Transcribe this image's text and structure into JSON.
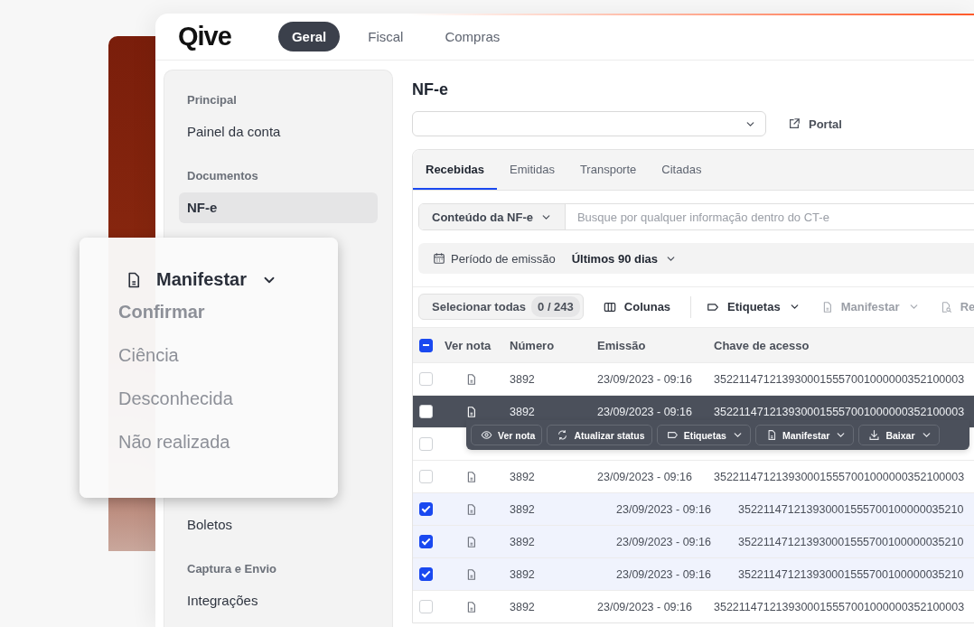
{
  "logo": "Qive",
  "nav_tabs": [
    {
      "label": "Geral",
      "selected": true
    },
    {
      "label": "Fiscal",
      "selected": false
    },
    {
      "label": "Compras",
      "selected": false
    }
  ],
  "sidebar": {
    "sections": [
      {
        "title": "Principal",
        "items": [
          {
            "label": "Painel da conta",
            "selected": false
          }
        ]
      },
      {
        "title": "Documentos",
        "items": [
          {
            "label": "NF-e",
            "selected": true
          }
        ]
      },
      {
        "items": [
          {
            "label": "Boletos",
            "selected": false
          }
        ]
      },
      {
        "title": "Captura e Envio",
        "items": [
          {
            "label": "Integrações",
            "selected": false
          }
        ]
      }
    ]
  },
  "page_title": "NF-e",
  "portal_link": "Portal",
  "doc_tabs": [
    {
      "label": "Recebidas",
      "selected": true
    },
    {
      "label": "Emitidas",
      "selected": false
    },
    {
      "label": "Transporte",
      "selected": false
    },
    {
      "label": "Citadas",
      "selected": false
    }
  ],
  "search": {
    "scope": "Conteúdo da NF-e",
    "placeholder": "Busque por qualquer informação dentro do CT-e"
  },
  "period_filter": {
    "label": "Período de emissão",
    "value": "Últimos 90 dias"
  },
  "toolbar": {
    "select_all": {
      "label": "Selecionar todas",
      "count": "0 / 243"
    },
    "actions": [
      {
        "kind": "columns",
        "label": "Colunas",
        "dropdown": false,
        "disabled": false
      },
      {
        "kind": "tag",
        "label": "Etiquetas",
        "dropdown": true,
        "disabled": false
      },
      {
        "kind": "doc",
        "label": "Manifestar",
        "dropdown": true,
        "disabled": true
      },
      {
        "kind": "search",
        "label": "Re",
        "dropdown": false,
        "disabled": true
      }
    ]
  },
  "table": {
    "partially_selected": true,
    "columns": [
      "Ver nota",
      "Número",
      "Emissão",
      "Chave de acesso"
    ],
    "rows": [
      {
        "checked": false,
        "hovered": false,
        "numero": "3892",
        "emissao": "23/09/2023 - 09:16",
        "chave": "3522114712139300015557001000000352100003"
      },
      {
        "checked": false,
        "hovered": true,
        "numero": "3892",
        "emissao": "23/09/2023 - 09:16",
        "chave": "3522114712139300015557001000000352100003"
      },
      {
        "checked": false,
        "hovered": false
      },
      {
        "checked": false,
        "hovered": false,
        "numero": "3892",
        "emissao": "23/09/2023 - 09:16",
        "chave": "3522114712139300015557001000000352100003"
      },
      {
        "checked": true,
        "hovered": false,
        "numero": "3892",
        "emissao": "23/09/2023 - 09:16",
        "chave": "352211471213930001555700100000035210"
      },
      {
        "checked": true,
        "hovered": false,
        "numero": "3892",
        "emissao": "23/09/2023 - 09:16",
        "chave": "352211471213930001555700100000035210"
      },
      {
        "checked": true,
        "hovered": false,
        "numero": "3892",
        "emissao": "23/09/2023 - 09:16",
        "chave": "352211471213930001555700100000035210"
      },
      {
        "checked": false,
        "hovered": false,
        "numero": "3892",
        "emissao": "23/09/2023 - 09:16",
        "chave": "3522114712139300015557001000000352100003"
      }
    ]
  },
  "row_actions": [
    {
      "kind": "eye",
      "label": "Ver nota",
      "dropdown": false
    },
    {
      "kind": "refresh",
      "label": "Atualizar status",
      "dropdown": false
    },
    {
      "kind": "tag",
      "label": "Etiquetas",
      "dropdown": true
    },
    {
      "kind": "doc",
      "label": "Manifestar",
      "dropdown": true
    },
    {
      "kind": "download",
      "label": "Baixar",
      "dropdown": true
    }
  ],
  "manifest_menu": {
    "title": "Manifestar",
    "options": [
      {
        "label": "Confirmar",
        "selected": true
      },
      {
        "label": "Ciência",
        "selected": false
      },
      {
        "label": "Desconhecida",
        "selected": false
      },
      {
        "label": "Não realizada",
        "selected": false
      }
    ]
  }
}
